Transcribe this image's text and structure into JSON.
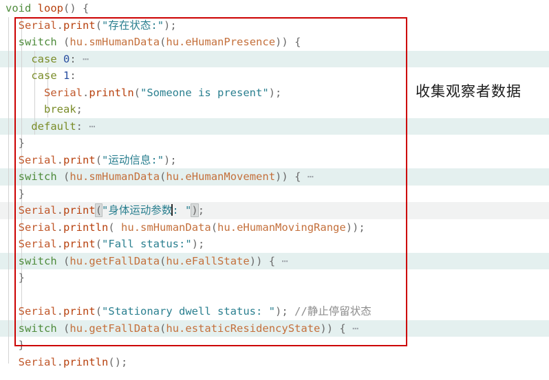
{
  "editor": {
    "language": "cpp",
    "colors": {
      "background": "#ffffff",
      "highlight_row": "#e4f0ef",
      "annotation_box": "#cc0000",
      "keyword": "#4e8b3b",
      "case_keyword": "#7a8c28",
      "object": "#c0582b",
      "function": "#b7410e",
      "string": "#2a7f8f",
      "number": "#2a4fa0",
      "identifier": "#c4703c",
      "comment": "#8d8d8d",
      "indent_guide": "#d3d3d3"
    },
    "lines": [
      {
        "id": "l1",
        "text": "void loop() {"
      },
      {
        "id": "l2",
        "text": "  Serial.print(\"存在状态:\");"
      },
      {
        "id": "l3",
        "text": "  switch (hu.smHumanData(hu.eHumanPresence)) {"
      },
      {
        "id": "l4",
        "text": "    case 0: ⋯"
      },
      {
        "id": "l5",
        "text": "    case 1:"
      },
      {
        "id": "l6",
        "text": "      Serial.println(\"Someone is present\");"
      },
      {
        "id": "l7",
        "text": "      break;"
      },
      {
        "id": "l8",
        "text": "    default: ⋯"
      },
      {
        "id": "l9",
        "text": "  }"
      },
      {
        "id": "l10",
        "text": "  Serial.print(\"运动信息:\");"
      },
      {
        "id": "l11",
        "text": "  switch (hu.smHumanData(hu.eHumanMovement)) { ⋯"
      },
      {
        "id": "l12",
        "text": "  }"
      },
      {
        "id": "l13",
        "text": "  Serial.print(\"身体运动参数: \");"
      },
      {
        "id": "l14",
        "text": "  Serial.println( hu.smHumanData(hu.eHumanMovingRange));"
      },
      {
        "id": "l15",
        "text": "  Serial.print(\"Fall status:\");"
      },
      {
        "id": "l16",
        "text": "  switch (hu.getFallData(hu.eFallState)) { ⋯"
      },
      {
        "id": "l17",
        "text": "  }"
      },
      {
        "id": "l18",
        "text": ""
      },
      {
        "id": "l19",
        "text": "  Serial.print(\"Stationary dwell status: \"); //静止停留状态"
      },
      {
        "id": "l20",
        "text": "  switch (hu.getFallData(hu.estaticResidencyState)) { ⋯"
      },
      {
        "id": "l21",
        "text": "  }"
      },
      {
        "id": "l22",
        "text": "  Serial.println();"
      }
    ],
    "tokens": {
      "void": "void",
      "loop": "loop",
      "paren_open": "(",
      "paren_close": ")",
      "brace_open": "{",
      "brace_close": "}",
      "serial": "Serial",
      "dot": ".",
      "print": "print",
      "println": "println",
      "switch": "switch",
      "case": "case",
      "break": "break",
      "default": "default",
      "semicolon": ";",
      "colon": ":",
      "comma": ",",
      "fold_ellipsis": "⋯",
      "hu": "hu",
      "smHumanData": "smHumanData",
      "getFallData": "getFallData",
      "eHumanPresence": "eHumanPresence",
      "eHumanMovement": "eHumanMovement",
      "eHumanMovingRange": "eHumanMovingRange",
      "eFallState": "eFallState",
      "estaticResidencyState": "estaticResidencyState",
      "num_zero": "0",
      "num_one": "1",
      "str_presence": "\"存在状态:\"",
      "str_someone": "\"Someone is present\"",
      "str_motion": "\"运动信息:\"",
      "str_body_param_a": "\"身体运动参数",
      "str_body_param_b": ": \"",
      "str_fall": "\"Fall status:\"",
      "str_dwell": "\"Stationary dwell status: \"",
      "comment_dwell": "//静止停留状态"
    }
  },
  "annotation": {
    "label": "收集观察者数据",
    "box_color": "#cc0000"
  }
}
